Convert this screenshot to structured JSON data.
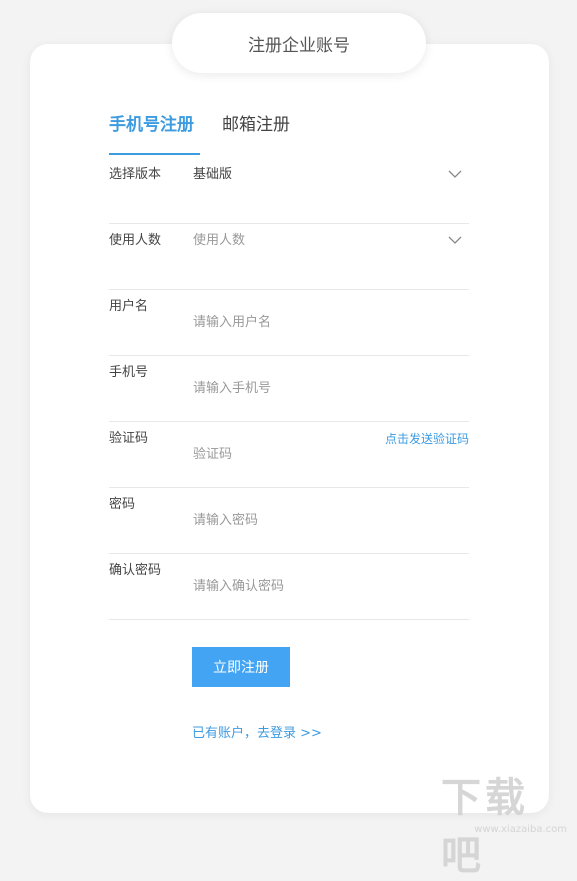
{
  "header": {
    "title": "注册企业账号"
  },
  "tabs": [
    {
      "label": "手机号注册",
      "active": true
    },
    {
      "label": "邮箱注册",
      "active": false
    }
  ],
  "form": {
    "edition": {
      "label": "选择版本",
      "value": "基础版",
      "icon": "chevron-down-icon"
    },
    "users": {
      "label": "使用人数",
      "placeholder": "使用人数",
      "icon": "chevron-down-icon"
    },
    "username": {
      "label": "用户名",
      "placeholder": "请输入用户名"
    },
    "phone": {
      "label": "手机号",
      "placeholder": "请输入手机号"
    },
    "code": {
      "label": "验证码",
      "placeholder": "验证码",
      "send_label": "点击发送验证码"
    },
    "password": {
      "label": "密码",
      "placeholder": "请输入密码"
    },
    "confirm": {
      "label": "确认密码",
      "placeholder": "请输入确认密码"
    }
  },
  "actions": {
    "submit_label": "立即注册",
    "login_link": "已有账户，去登录 >>"
  },
  "watermark": {
    "text": "下载吧",
    "url": "www.xiazaiba.com"
  },
  "colors": {
    "accent": "#3d9be0",
    "button": "#42a4f2",
    "background": "#f3f3f3"
  }
}
